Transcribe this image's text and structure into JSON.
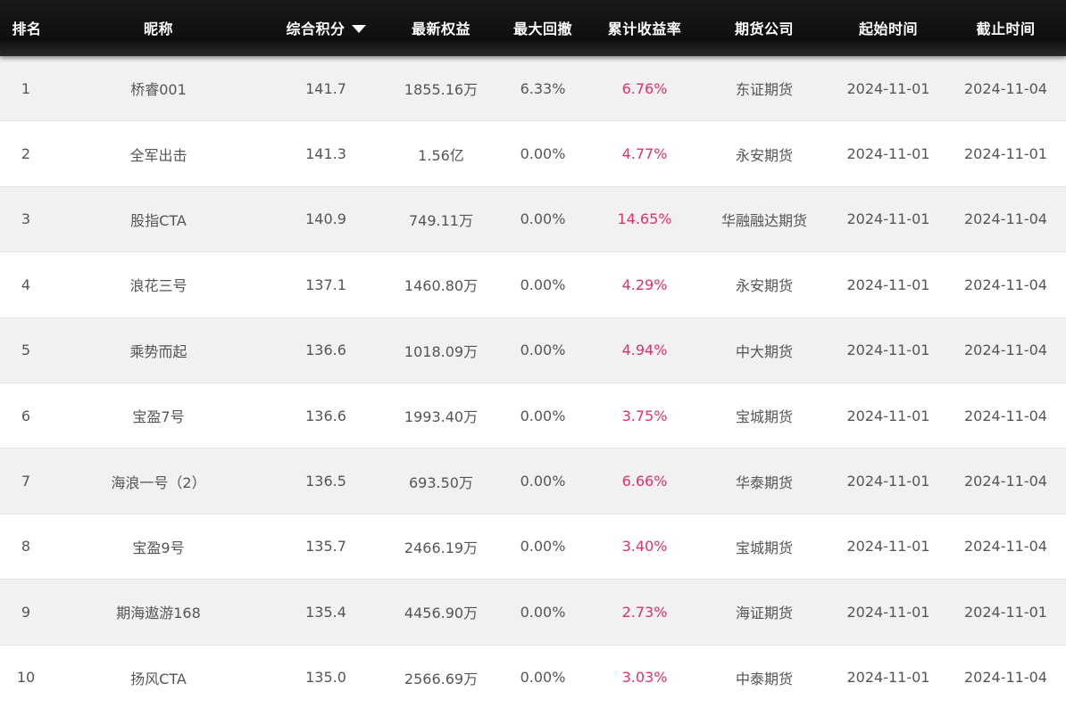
{
  "header": {
    "rank": "排名",
    "nickname": "昵称",
    "score": "综合积分",
    "equity": "最新权益",
    "drawdown": "最大回撤",
    "return_rate": "累计收益率",
    "company": "期货公司",
    "start_date": "起始时间",
    "end_date": "截止时间"
  },
  "colors": {
    "header_bg": "#111111",
    "row_alt_bg": "#f1f1f1",
    "rate_color": "#e0306a",
    "text_color": "#555555"
  },
  "rows": [
    {
      "rank": "1",
      "nickname": "桥睿001",
      "score": "141.7",
      "equity": "1855.16万",
      "drawdown": "6.33%",
      "return_rate": "6.76%",
      "company": "东证期货",
      "start_date": "2024-11-01",
      "end_date": "2024-11-04"
    },
    {
      "rank": "2",
      "nickname": "全军出击",
      "score": "141.3",
      "equity": "1.56亿",
      "drawdown": "0.00%",
      "return_rate": "4.77%",
      "company": "永安期货",
      "start_date": "2024-11-01",
      "end_date": "2024-11-01"
    },
    {
      "rank": "3",
      "nickname": "股指CTA",
      "score": "140.9",
      "equity": "749.11万",
      "drawdown": "0.00%",
      "return_rate": "14.65%",
      "company": "华融融达期货",
      "start_date": "2024-11-01",
      "end_date": "2024-11-04"
    },
    {
      "rank": "4",
      "nickname": "浪花三号",
      "score": "137.1",
      "equity": "1460.80万",
      "drawdown": "0.00%",
      "return_rate": "4.29%",
      "company": "永安期货",
      "start_date": "2024-11-01",
      "end_date": "2024-11-04"
    },
    {
      "rank": "5",
      "nickname": "乘势而起",
      "score": "136.6",
      "equity": "1018.09万",
      "drawdown": "0.00%",
      "return_rate": "4.94%",
      "company": "中大期货",
      "start_date": "2024-11-01",
      "end_date": "2024-11-04"
    },
    {
      "rank": "6",
      "nickname": "宝盈7号",
      "score": "136.6",
      "equity": "1993.40万",
      "drawdown": "0.00%",
      "return_rate": "3.75%",
      "company": "宝城期货",
      "start_date": "2024-11-01",
      "end_date": "2024-11-04"
    },
    {
      "rank": "7",
      "nickname": "海浪一号（2）",
      "score": "136.5",
      "equity": "693.50万",
      "drawdown": "0.00%",
      "return_rate": "6.66%",
      "company": "华泰期货",
      "start_date": "2024-11-01",
      "end_date": "2024-11-04"
    },
    {
      "rank": "8",
      "nickname": "宝盈9号",
      "score": "135.7",
      "equity": "2466.19万",
      "drawdown": "0.00%",
      "return_rate": "3.40%",
      "company": "宝城期货",
      "start_date": "2024-11-01",
      "end_date": "2024-11-04"
    },
    {
      "rank": "9",
      "nickname": "期海遨游168",
      "score": "135.4",
      "equity": "4456.90万",
      "drawdown": "0.00%",
      "return_rate": "2.73%",
      "company": "海证期货",
      "start_date": "2024-11-01",
      "end_date": "2024-11-01"
    },
    {
      "rank": "10",
      "nickname": "扬风CTA",
      "score": "135.0",
      "equity": "2566.69万",
      "drawdown": "0.00%",
      "return_rate": "3.03%",
      "company": "中泰期货",
      "start_date": "2024-11-01",
      "end_date": "2024-11-04"
    }
  ]
}
